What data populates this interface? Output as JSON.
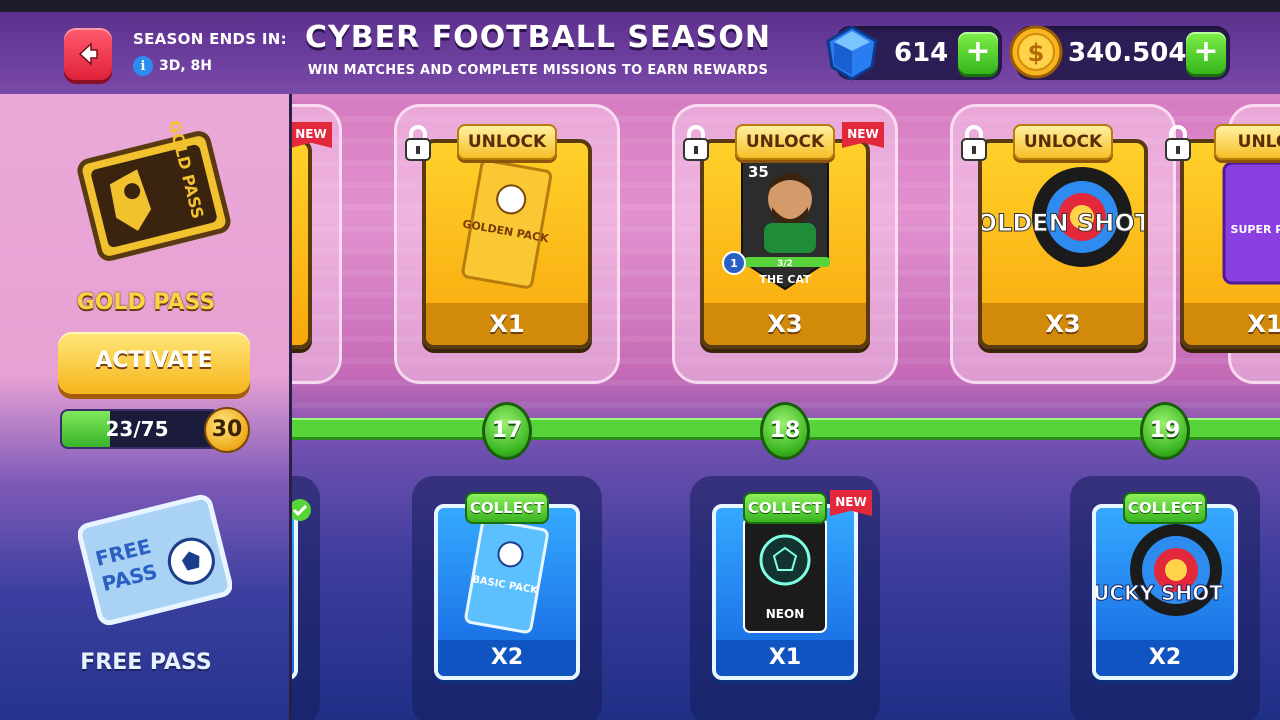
{
  "header": {
    "season_label": "SEASON ENDS IN:",
    "season_time": "3D, 8H",
    "title": "CYBER FOOTBALL SEASON",
    "subtitle": "WIN MATCHES AND COMPLETE MISSIONS TO EARN REWARDS",
    "gems": "614",
    "coins": "340.504",
    "plus_label": "+"
  },
  "sidebar": {
    "gold_pass_label": "GOLD PASS",
    "activate_label": "ACTIVATE",
    "progress_text": "23/75",
    "progress_fraction": 0.3067,
    "level": "30",
    "free_pass_label": "FREE PASS",
    "gold_pass_art_text": "GOLD PASS",
    "free_pass_art_text": "FREE PASS"
  },
  "track": {
    "levels": [
      "17",
      "18",
      "19"
    ],
    "gold_rewards": [
      {
        "tag": "UNLOCK",
        "item": "GOLDEN PACK",
        "qty": "X1",
        "new": false
      },
      {
        "tag": "UNLOCK",
        "item": "THE CAT",
        "rating": "35",
        "level": "1",
        "progress": "3/2",
        "qty": "X3",
        "new": true,
        "new_label": "NEW"
      },
      {
        "tag": "UNLOCK",
        "item": "GOLDEN SHOT",
        "qty": "X3",
        "new": false
      },
      {
        "tag": "UNLO",
        "item": "SUPER PACK",
        "qty": "X1",
        "new": false
      }
    ],
    "partial_left_new": "NEW",
    "free_rewards": [
      {
        "tag": "COLLECT",
        "item": "BASIC PACK",
        "qty": "X2",
        "new": false
      },
      {
        "tag": "COLLECT",
        "item": "NEON",
        "qty": "X1",
        "new": true,
        "new_label": "NEW"
      },
      {
        "tag": "COLLECT",
        "item": "LUCKY SHOT",
        "qty": "X2",
        "new": false
      }
    ]
  },
  "colors": {
    "accent_green": "#56d43a",
    "gold": "#f8a80c",
    "blue": "#1565e0",
    "red": "#e3283c"
  }
}
